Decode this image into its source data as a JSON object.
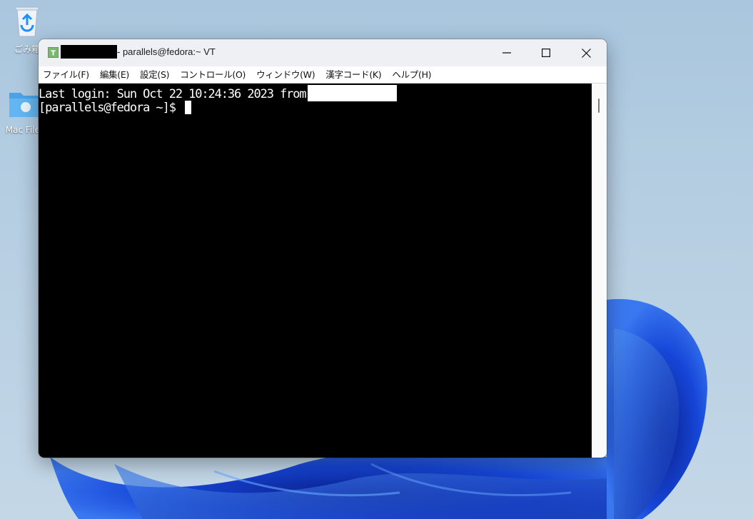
{
  "desktop": {
    "icons": [
      {
        "label": "ごみ箱",
        "icon": "recycle-bin-icon"
      },
      {
        "label": "Mac Files",
        "icon": "mac-folder-icon"
      }
    ]
  },
  "window": {
    "title": "- parallels@fedora:~ VT",
    "controls": {
      "minimize": "minimize-icon",
      "maximize": "maximize-icon",
      "close": "close-icon"
    },
    "menu": [
      {
        "label": "ファイル(F)"
      },
      {
        "label": "編集(E)"
      },
      {
        "label": "設定(S)"
      },
      {
        "label": "コントロール(O)"
      },
      {
        "label": "ウィンドウ(W)"
      },
      {
        "label": "漢字コード(K)"
      },
      {
        "label": "ヘルプ(H)"
      }
    ],
    "terminal": {
      "line1": "Last login: Sun Oct 22 10:24:36 2023 from",
      "prompt": "[parallels@fedora ~]$ "
    }
  },
  "colors": {
    "terminal_bg": "#000000",
    "terminal_fg": "#ffffff",
    "wallpaper_accent": "#1a4fd6"
  }
}
